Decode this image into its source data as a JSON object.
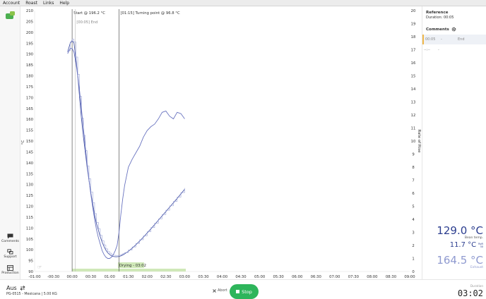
{
  "menu": [
    "Account",
    "Roast",
    "Links",
    "Help"
  ],
  "nav": {
    "comments_label": "Comments",
    "support_label": "Support",
    "production_label": "Production"
  },
  "right_panel": {
    "reference_title": "Reference",
    "reference_duration": "Duration: 00:05",
    "comments_title": "Comments",
    "comment_rows": [
      {
        "time": "00:05",
        "dash": "-",
        "text": "End"
      },
      {
        "time": "--:--",
        "dash": "-",
        "text": ""
      }
    ],
    "bean_temp": "129.0 °C",
    "bean_temp_label": "Bean temp.",
    "ror": "11.7 °C",
    "ror_unit_top": "RoR",
    "ror_unit_bottom": "30",
    "exhaust": "164.5 °C",
    "exhaust_label": "Exhaust"
  },
  "bottom": {
    "mode": "Aus",
    "profile": "PG-0515 - Mexicana | 5.00 KG",
    "abort_label": "Abort",
    "stop_label": "Stop",
    "duration_label": "Duration",
    "duration_value": "03:02"
  },
  "chart_data": {
    "type": "line",
    "ylabel": "°C",
    "y2label": "Rate of Rise",
    "xlim": [
      -1.0,
      9.0
    ],
    "ylim": [
      90,
      210
    ],
    "y2lim": [
      0,
      20
    ],
    "x_ticks": [
      "-01:00",
      "-00:30",
      "00:00",
      "00:30",
      "01:00",
      "01:30",
      "02:00",
      "02:30",
      "03:00",
      "03:30",
      "04:00",
      "04:30",
      "05:00",
      "05:30",
      "06:00",
      "06:30",
      "07:00",
      "07:30",
      "08:00",
      "08:30",
      "09:00"
    ],
    "y_ticks": [
      90,
      95,
      100,
      105,
      110,
      115,
      120,
      125,
      130,
      135,
      140,
      145,
      150,
      155,
      160,
      165,
      170,
      175,
      180,
      185,
      190,
      195,
      200,
      205,
      210
    ],
    "y2_ticks": [
      0,
      1,
      2,
      3,
      4,
      5,
      6,
      7,
      8,
      9,
      10,
      11,
      12,
      13,
      14,
      15,
      16,
      17,
      18,
      19,
      20
    ],
    "markers": [
      {
        "x": 0.0,
        "label": "Start @ 196.2 °C"
      },
      {
        "x": 1.25,
        "label": "[01:15] Turning point @ 96.8 °C"
      }
    ],
    "ref_marker": {
      "x": 0.08,
      "label": "[00:05] End"
    },
    "phase": {
      "label": "Drying - 03:02",
      "start": 0.0,
      "end": 3.03
    },
    "series": [
      {
        "name": "",
        "axis": "temp",
        "x": [
          -0.12,
          -0.05,
          0.0,
          0.05,
          0.1,
          0.15,
          0.2,
          0.25,
          0.3,
          0.35,
          0.4,
          0.45,
          0.5,
          0.55,
          0.6,
          0.65,
          0.7,
          0.75,
          0.8,
          0.85,
          0.9,
          0.95,
          1.0,
          1.05,
          1.1,
          1.15,
          1.2,
          1.25,
          1.3,
          1.35,
          1.4,
          1.5,
          1.6,
          1.7,
          1.8,
          1.9,
          2.0,
          2.1,
          2.2,
          2.3,
          2.4,
          2.5,
          2.6,
          2.7,
          2.8,
          2.9,
          3.0
        ],
        "y": [
          191,
          195,
          196.2,
          195,
          188,
          180,
          170,
          160,
          152,
          145,
          138,
          132,
          126,
          121,
          116,
          112,
          109,
          106,
          103.5,
          101.5,
          99.8,
          98.6,
          97.8,
          97.2,
          96.9,
          96.8,
          96.8,
          96.9,
          97.2,
          97.6,
          98.1,
          99.3,
          100.7,
          102.3,
          104,
          105.8,
          107.7,
          109.6,
          111.6,
          113.6,
          115.6,
          117.6,
          119.6,
          121.6,
          123.6,
          125.7,
          127.8
        ]
      },
      {
        "name": "",
        "axis": "ror",
        "x": [
          -0.12,
          -0.05,
          0.0,
          0.05,
          0.1,
          0.15,
          0.2,
          0.25,
          0.3,
          0.35,
          0.4,
          0.45,
          0.5,
          0.55,
          0.6,
          0.65,
          0.7,
          0.75,
          0.8,
          0.85,
          0.9,
          0.95,
          1.0,
          1.05,
          1.1,
          1.15,
          1.2,
          1.25,
          1.3,
          1.35,
          1.4,
          1.5,
          1.6,
          1.7,
          1.8,
          1.9,
          2.0,
          2.1,
          2.2,
          2.3,
          2.4,
          2.5,
          2.6,
          2.7,
          2.8,
          2.9,
          3.0
        ],
        "y": [
          16.7,
          17.1,
          17.1,
          16.8,
          16.0,
          15.0,
          13.8,
          12.4,
          11.0,
          9.6,
          8.2,
          7.0,
          5.9,
          4.9,
          4.0,
          3.2,
          2.6,
          2.1,
          1.6,
          1.3,
          1.1,
          1.0,
          1.0,
          1.1,
          1.3,
          1.6,
          2.0,
          3.0,
          4.4,
          5.6,
          6.6,
          8.0,
          8.6,
          9.1,
          9.6,
          10.3,
          10.8,
          11.1,
          11.3,
          11.7,
          12.2,
          12.3,
          11.9,
          11.7,
          12.2,
          12.1,
          11.7
        ]
      }
    ],
    "grid": false,
    "legend": "none"
  }
}
